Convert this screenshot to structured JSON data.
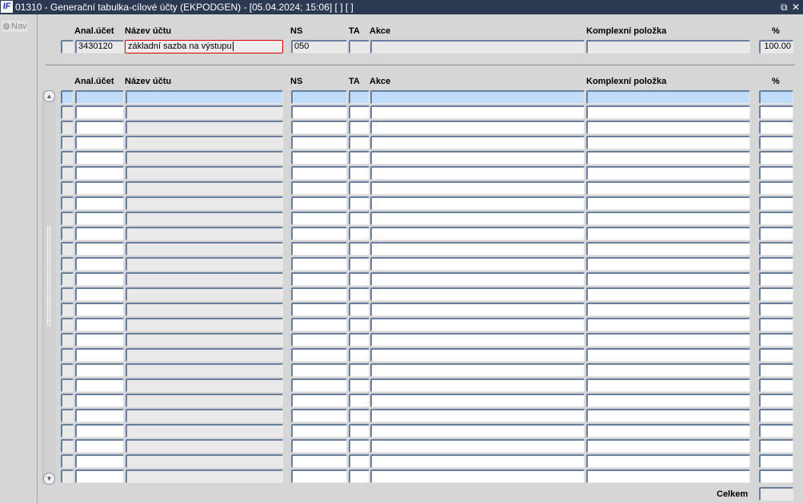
{
  "window": {
    "logo": "IF",
    "title": "01310 - Generační tabulka-cílové účty (EKPODGEN) - [05.04.2024; 15:06]  [ ]  [ ]",
    "restore_icon": "restore-icon",
    "close_icon": "close-icon"
  },
  "sidebar": {
    "nav_label": "Nav"
  },
  "columns": {
    "anal": "Anal.účet",
    "nazev": "Název účtu",
    "ns": "NS",
    "ta": "TA",
    "akce": "Akce",
    "komplex": "Komplexní položka",
    "pct": "%"
  },
  "master": {
    "anal": "3430120",
    "nazev": "základní sazba na výstupu",
    "ns": "050",
    "ta": "",
    "akce": "",
    "komplex": "",
    "pct": "100.00"
  },
  "detail": {
    "visible_rows": 26
  },
  "footer": {
    "total_label": "Celkem",
    "total_value": ""
  }
}
